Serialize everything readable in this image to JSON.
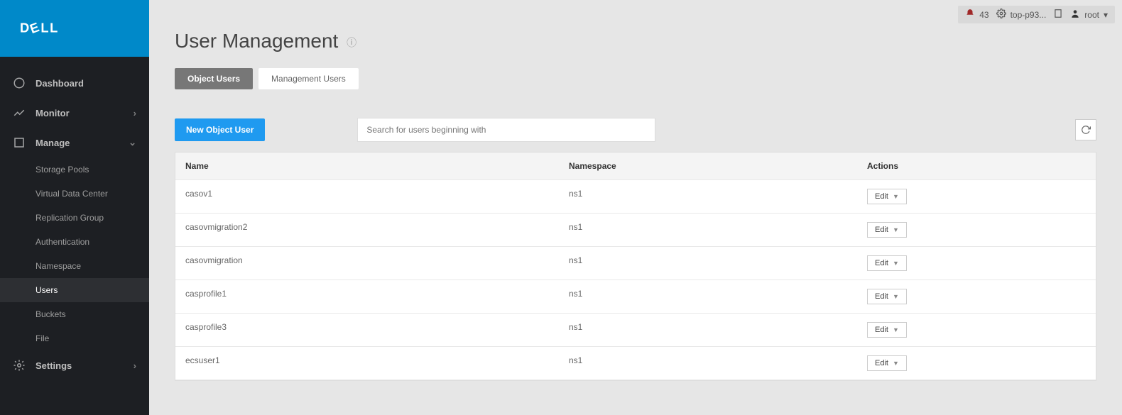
{
  "brand_text": "DELL",
  "topbar": {
    "alert_count": "43",
    "identity_label": "top-p93...",
    "user_label": "root"
  },
  "page": {
    "title": "User Management"
  },
  "nav": {
    "dashboard": "Dashboard",
    "monitor": "Monitor",
    "manage": "Manage",
    "settings": "Settings",
    "manage_children": [
      "Storage Pools",
      "Virtual Data Center",
      "Replication Group",
      "Authentication",
      "Namespace",
      "Users",
      "Buckets",
      "File"
    ],
    "active_child_index": 5
  },
  "tabs": [
    {
      "label": "Object Users",
      "active": true
    },
    {
      "label": "Management Users",
      "active": false
    }
  ],
  "toolbar": {
    "new_button": "New Object User",
    "search_placeholder": "Search for users beginning with"
  },
  "table": {
    "columns": [
      "Name",
      "Namespace",
      "Actions"
    ],
    "action_label": "Edit",
    "rows": [
      {
        "name": "casov1",
        "namespace": "ns1"
      },
      {
        "name": "casovmigration2",
        "namespace": "ns1"
      },
      {
        "name": "casovmigration",
        "namespace": "ns1"
      },
      {
        "name": "casprofile1",
        "namespace": "ns1"
      },
      {
        "name": "casprofile3",
        "namespace": "ns1"
      },
      {
        "name": "ecsuser1",
        "namespace": "ns1"
      }
    ]
  }
}
